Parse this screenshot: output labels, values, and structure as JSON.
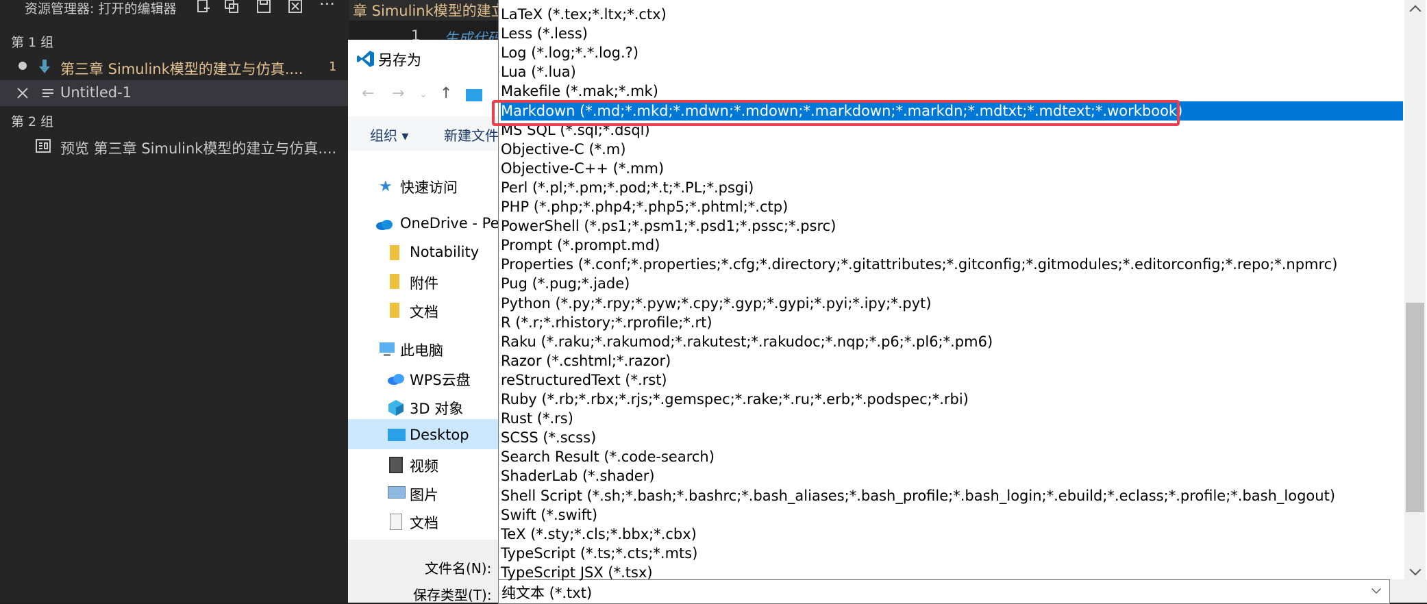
{
  "vscode": {
    "explorer_title": "资源管理器: 打开的编辑器",
    "group1": "第 1 组",
    "group2": "第 2 组",
    "editors": [
      {
        "label": "第三章 Simulink模型的建立与仿真....",
        "count": "1"
      },
      {
        "label": "Untitled-1"
      },
      {
        "label": "预览 第三章 Simulink模型的建立与仿真...."
      }
    ],
    "tab_text": "章 Simulink模型的建立与仿真",
    "line_number": "1",
    "editor_text": "生成代码"
  },
  "dialog": {
    "title": "另存为",
    "organize": "组织",
    "new_folder": "新建文件夹",
    "nav": {
      "quick_access": "快速访问",
      "onedrive": "OneDrive - Pe",
      "notability": "Notability",
      "attachments": "附件",
      "docs1": "文档",
      "this_pc": "此电脑",
      "wps": "WPS云盘",
      "objects3d": "3D 对象",
      "desktop": "Desktop",
      "videos": "视频",
      "pictures": "图片",
      "docs2": "文档"
    },
    "filename_label": "文件名(N):",
    "savetype_label": "保存类型(T):",
    "savetype_value": "纯文本 (*.txt)"
  },
  "dropdown": {
    "options": [
      "LaTeX (*.tex;*.ltx;*.ctx)",
      "Less (*.less)",
      "Log (*.log;*.*.log.?)",
      "Lua (*.lua)",
      "Makefile (*.mak;*.mk)",
      "Markdown (*.md;*.mkd;*.mdwn;*.mdown;*.markdown;*.markdn;*.mdtxt;*.mdtext;*.workbook)",
      "MS SQL (*.sql;*.dsql)",
      "Objective-C (*.m)",
      "Objective-C++ (*.mm)",
      "Perl (*.pl;*.pm;*.pod;*.t;*.PL;*.psgi)",
      "PHP (*.php;*.php4;*.php5;*.phtml;*.ctp)",
      "PowerShell (*.ps1;*.psm1;*.psd1;*.pssc;*.psrc)",
      "Prompt (*.prompt.md)",
      "Properties (*.conf;*.properties;*.cfg;*.directory;*.gitattributes;*.gitconfig;*.gitmodules;*.editorconfig;*.repo;*.npmrc)",
      "Pug (*.pug;*.jade)",
      "Python (*.py;*.rpy;*.pyw;*.cpy;*.gyp;*.gypi;*.pyi;*.ipy;*.pyt)",
      "R (*.r;*.rhistory;*.rprofile;*.rt)",
      "Raku (*.raku;*.rakumod;*.rakutest;*.rakudoc;*.nqp;*.p6;*.pl6;*.pm6)",
      "Razor (*.cshtml;*.razor)",
      "reStructuredText (*.rst)",
      "Ruby (*.rb;*.rbx;*.rjs;*.gemspec;*.rake;*.ru;*.erb;*.podspec;*.rbi)",
      "Rust (*.rs)",
      "SCSS (*.scss)",
      "Search Result (*.code-search)",
      "ShaderLab (*.shader)",
      "Shell Script (*.sh;*.bash;*.bashrc;*.bash_aliases;*.bash_profile;*.bash_login;*.ebuild;*.eclass;*.profile;*.bash_logout)",
      "Swift (*.swift)",
      "TeX (*.sty;*.cls;*.bbx;*.cbx)",
      "TypeScript (*.ts;*.cts;*.mts)",
      "TypeScript JSX (*.tsx)"
    ],
    "selected_index": 5,
    "highlight_color": "#0078d7",
    "annotation_color": "#e8404e"
  }
}
